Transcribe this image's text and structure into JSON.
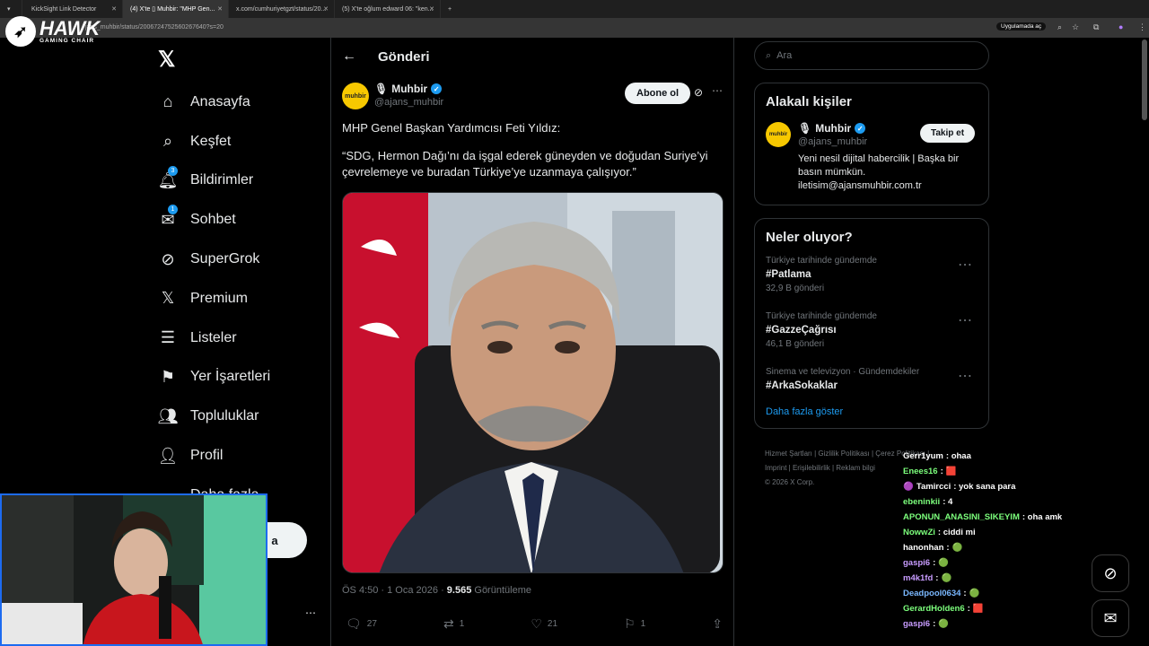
{
  "browser": {
    "tabs": [
      {
        "label": "KickSight Link Detector"
      },
      {
        "label": "(4) X'te ▯ Muhbir: \"MHP Gen..."
      },
      {
        "label": "x.com/cumhuriyetgzt/status/20..."
      },
      {
        "label": "(5) X'te oğlum edward 06: \"ken..."
      }
    ],
    "url": "jans_muhbir/status/2006724752560267640?s=20",
    "app_button": "Uygulamada aç"
  },
  "overlay_logo": {
    "title": "HAWK",
    "subtitle": "GAMING CHAIR"
  },
  "nav": {
    "items": [
      {
        "label": "Anasayfa",
        "icon": "home-icon"
      },
      {
        "label": "Keşfet",
        "icon": "search-icon"
      },
      {
        "label": "Bildirimler",
        "icon": "bell-icon",
        "badge": "3"
      },
      {
        "label": "Sohbet",
        "icon": "mail-icon",
        "badge": "1"
      },
      {
        "label": "SuperGrok",
        "icon": "grok-icon"
      },
      {
        "label": "Premium",
        "icon": "x-icon"
      },
      {
        "label": "Listeler",
        "icon": "list-icon"
      },
      {
        "label": "Yer İşaretleri",
        "icon": "bookmark-icon"
      },
      {
        "label": "Topluluklar",
        "icon": "people-icon"
      },
      {
        "label": "Profil",
        "icon": "person-icon"
      },
      {
        "label": "Daha fazla",
        "icon": "more-icon"
      }
    ],
    "post_button": "a"
  },
  "post": {
    "header_title": "Gönderi",
    "author_name": "Muhbir",
    "author_handle": "@ajans_muhbir",
    "avatar_text": "muhbir",
    "subscribe_label": "Abone ol",
    "text_line1": "MHP Genel Başkan Yardımcısı Feti Yıldız:",
    "text_line2": "“SDG, Hermon Dağı’nı da işgal ederek güneyden ve doğudan Suriye’yi çevrelemeye ve buradan Türkiye’ye uzanmaya çalışıyor.”",
    "time": "ÖS 4:50 · 1 Oca 2026 · ",
    "views": "9.565",
    "views_label": " Görüntüleme",
    "actions": {
      "replies": "27",
      "reposts": "1",
      "likes": "21",
      "bookmarks": "1"
    }
  },
  "sidebar": {
    "search_placeholder": "Ara",
    "related_title": "Alakalı kişiler",
    "related": {
      "name": "Muhbir",
      "handle": "@ajans_muhbir",
      "bio": "Yeni nesil dijital habercilik | Başka bir basın mümkün. iletisim@ajansmuhbir.com.tr",
      "follow_label": "Takip et"
    },
    "trends_title": "Neler oluyor?",
    "trends": [
      {
        "context": "Türkiye tarihinde gündemde",
        "tag": "#Patlama",
        "count": "32,9 B gönderi"
      },
      {
        "context": "Türkiye tarihinde gündemde",
        "tag": "#GazzeÇağrısı",
        "count": "46,1 B gönderi"
      },
      {
        "context": "Sinema ve televizyon · Gündemdekiler",
        "tag": "#ArkaSokaklar",
        "count": ""
      }
    ],
    "show_more": "Daha fazla göster",
    "footer_line1": "Hizmet Şartları  |  Gizlilik Politikası  |  Çerez Politikası  |",
    "footer_line2": "Imprint  |  Erişilebilirlik  |  Reklam bilgi",
    "footer_line3": "© 2026 X Corp."
  },
  "chat": [
    {
      "user": "Gerr1yum",
      "msg": ": ohaa",
      "color": "#ffffff"
    },
    {
      "user": "Enees16",
      "msg": ":",
      "color": "#7cff7c"
    },
    {
      "user": "Tamircci",
      "msg": ": yok sana para",
      "color": "#ffffff"
    },
    {
      "user": "ebeninkii",
      "msg": ": 4",
      "color": "#7cff7c"
    },
    {
      "user": "APONUN_ANASINI_SIKEYIM",
      "msg": ": oha amk",
      "color": "#7cff7c"
    },
    {
      "user": "NowwZi",
      "msg": ": ciddi mi",
      "color": "#7cff7c"
    },
    {
      "user": "hanonhan",
      "msg": ":",
      "color": "#ffffff"
    },
    {
      "user": "gaspi6",
      "msg": ":",
      "color": "#c89cff"
    },
    {
      "user": "m4k1fd",
      "msg": ":",
      "color": "#c89cff"
    },
    {
      "user": "Deadpool0634",
      "msg": ":",
      "color": "#7ab8ff"
    },
    {
      "user": "GerardHolden6",
      "msg": ":",
      "color": "#7cff7c"
    },
    {
      "user": "gaspi6",
      "msg": ":",
      "color": "#c89cff"
    }
  ]
}
